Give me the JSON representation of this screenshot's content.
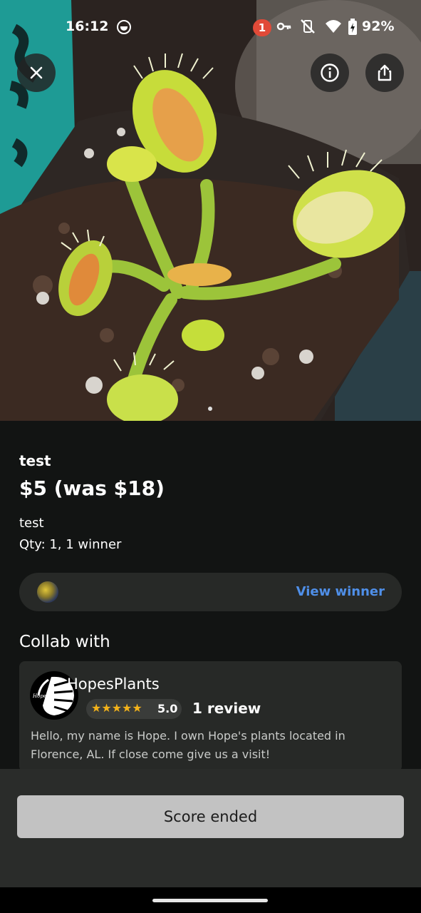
{
  "status_bar": {
    "time": "16:12",
    "notification_count": "1",
    "battery": "92%"
  },
  "listing": {
    "title": "test",
    "price": "$5 (was $18)",
    "description": "test",
    "quantity": "Qty: 1, 1 winner",
    "view_winner_label": "View winner"
  },
  "collab": {
    "heading": "Collab with",
    "seller_name": "HopesPlants",
    "logo_text": "Hope's Plants",
    "rating_value": "5.0",
    "rating_stars": 5,
    "review_count": "1 review",
    "bio": "Hello, my name is Hope. I own Hope's plants located in Florence, AL. If close come give us a visit!"
  },
  "footer": {
    "score_button_label": "Score ended"
  },
  "icons": {
    "close": "close-icon",
    "info": "info-icon",
    "share": "share-icon"
  },
  "colors": {
    "accent_link": "#4f8fe8",
    "star": "#f3b21a",
    "badge": "#e14a38"
  }
}
